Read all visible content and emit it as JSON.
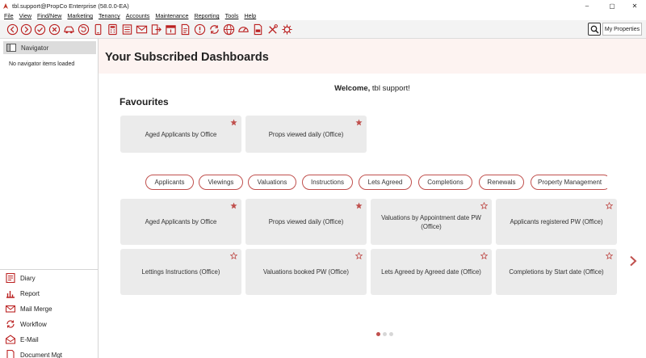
{
  "window": {
    "title": "tbl.support@PropCo Enterprise (58.0.0-EA)",
    "controls": {
      "minimize": "–",
      "maximize": "▢",
      "close": "✕"
    }
  },
  "menu": [
    "File",
    "View",
    "Find/New",
    "Marketing",
    "Tenancy",
    "Accounts",
    "Maintenance",
    "Reporting",
    "Tools",
    "Help"
  ],
  "toolbar": {
    "icons": [
      "back-icon",
      "forward-icon",
      "check-icon",
      "cancel-icon",
      "car-icon",
      "refresh-icon",
      "mobile-icon",
      "calculator-icon",
      "list-icon",
      "mail-icon",
      "exit-icon",
      "calendar-icon",
      "document-icon",
      "alert-icon",
      "sync-icon",
      "globe-icon",
      "gauge-icon",
      "pdf-icon",
      "tools-icon",
      "virus-icon"
    ],
    "my_properties_label": "My Properties"
  },
  "sidebar": {
    "header": "Navigator",
    "empty_text": "No navigator items loaded",
    "items": [
      "Diary",
      "Report",
      "Mail Merge",
      "Workflow",
      "E-Mail",
      "Document Mgt"
    ]
  },
  "main": {
    "title": "Your Subscribed Dashboards",
    "welcome_prefix": "Welcome,",
    "welcome_name": "tbl support!",
    "favourites_heading": "Favourites",
    "favourites": [
      {
        "label": "Aged Applicants by Office",
        "starred": true
      },
      {
        "label": "Props viewed daily (Office)",
        "starred": true
      }
    ],
    "tabs": [
      "Applicants",
      "Viewings",
      "Valuations",
      "Instructions",
      "Lets Agreed",
      "Completions",
      "Renewals",
      "Property Management"
    ],
    "dashboards": [
      {
        "label": "Aged Applicants by Office",
        "starred": true
      },
      {
        "label": "Props viewed daily (Office)",
        "starred": true
      },
      {
        "label": "Valuations by Appointment date PW (Office)",
        "starred": false
      },
      {
        "label": "Applicants registered PW (Office)",
        "starred": false
      },
      {
        "label": "Lettings Instructions (Office)",
        "starred": false
      },
      {
        "label": "Valuations booked PW (Office)",
        "starred": false
      },
      {
        "label": "Lets Agreed by Agreed date (Office)",
        "starred": false
      },
      {
        "label": "Completions by Start date (Office)",
        "starred": false
      }
    ],
    "pager": {
      "pages": 3,
      "current": 1
    }
  },
  "colors": {
    "accent": "#c0504d",
    "card_bg": "#ebebeb",
    "header_bg": "#fdf3f1"
  }
}
